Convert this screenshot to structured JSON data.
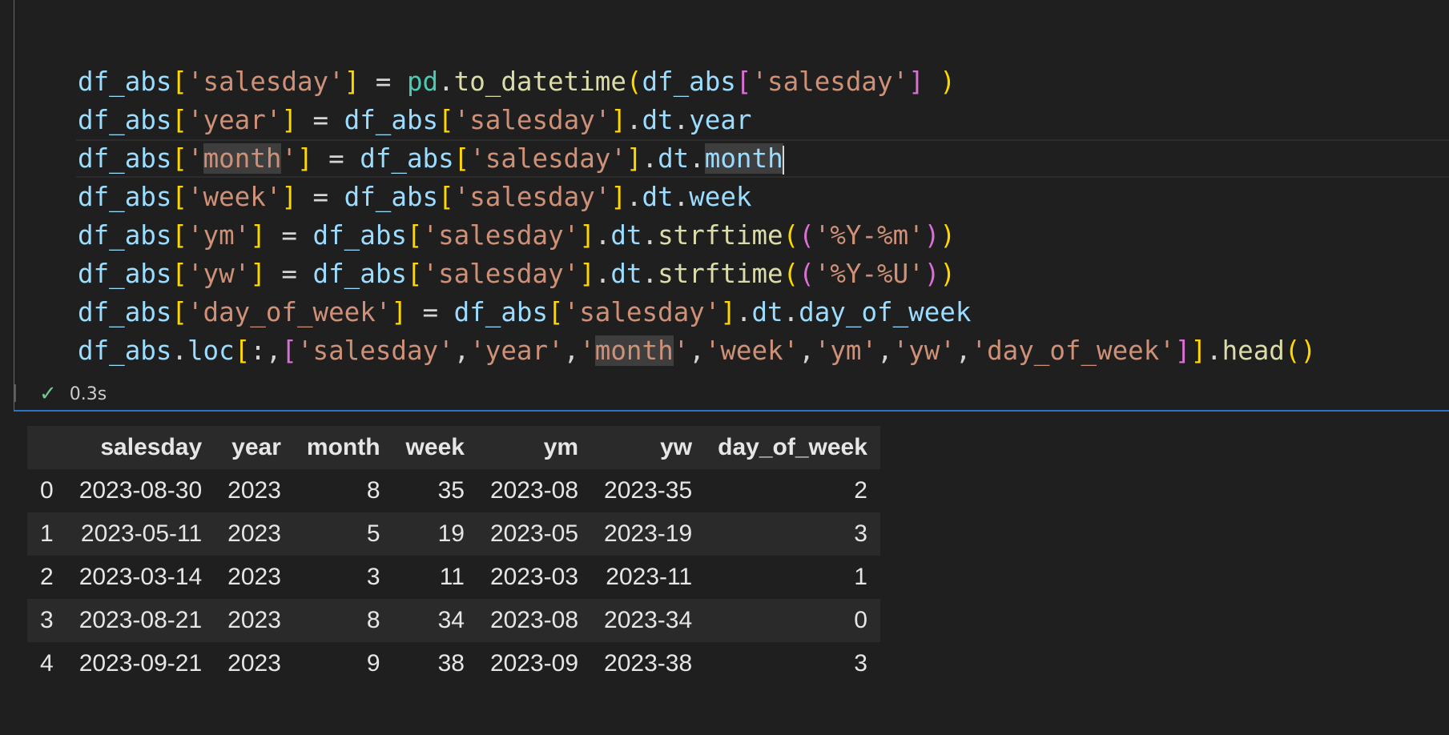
{
  "cell": {
    "lines": [
      [
        [
          "var",
          "df_abs"
        ],
        [
          "b1",
          "["
        ],
        [
          "str",
          "'salesday'"
        ],
        [
          "b1",
          "]"
        ],
        [
          "op",
          " = "
        ],
        [
          "mod",
          "pd"
        ],
        [
          "op",
          "."
        ],
        [
          "fn",
          "to_datetime"
        ],
        [
          "b1",
          "("
        ],
        [
          "var",
          "df_abs"
        ],
        [
          "b2",
          "["
        ],
        [
          "str",
          "'salesday'"
        ],
        [
          "b2",
          "]"
        ],
        [
          "op",
          " "
        ],
        [
          "b1",
          ")"
        ]
      ],
      [
        [
          "var",
          "df_abs"
        ],
        [
          "b1",
          "["
        ],
        [
          "str",
          "'year'"
        ],
        [
          "b1",
          "]"
        ],
        [
          "op",
          " = "
        ],
        [
          "var",
          "df_abs"
        ],
        [
          "b1",
          "["
        ],
        [
          "str",
          "'salesday'"
        ],
        [
          "b1",
          "]"
        ],
        [
          "op",
          "."
        ],
        [
          "var",
          "dt"
        ],
        [
          "op",
          "."
        ],
        [
          "var",
          "year"
        ]
      ],
      [
        [
          "var",
          "df_abs"
        ],
        [
          "b1",
          "["
        ],
        [
          "str",
          "'"
        ],
        [
          "str hl",
          "month"
        ],
        [
          "str",
          "'"
        ],
        [
          "b1",
          "]"
        ],
        [
          "op",
          " = "
        ],
        [
          "var",
          "df_abs"
        ],
        [
          "b1",
          "["
        ],
        [
          "str",
          "'salesday'"
        ],
        [
          "b1",
          "]"
        ],
        [
          "op",
          "."
        ],
        [
          "var",
          "dt"
        ],
        [
          "op",
          "."
        ],
        [
          "var hl",
          "month"
        ],
        [
          "cursor",
          ""
        ]
      ],
      [
        [
          "var",
          "df_abs"
        ],
        [
          "b1",
          "["
        ],
        [
          "str",
          "'week'"
        ],
        [
          "b1",
          "]"
        ],
        [
          "op",
          " = "
        ],
        [
          "var",
          "df_abs"
        ],
        [
          "b1",
          "["
        ],
        [
          "str",
          "'salesday'"
        ],
        [
          "b1",
          "]"
        ],
        [
          "op",
          "."
        ],
        [
          "var",
          "dt"
        ],
        [
          "op",
          "."
        ],
        [
          "var",
          "week"
        ]
      ],
      [
        [
          "var",
          "df_abs"
        ],
        [
          "b1",
          "["
        ],
        [
          "str",
          "'ym'"
        ],
        [
          "b1",
          "]"
        ],
        [
          "op",
          " = "
        ],
        [
          "var",
          "df_abs"
        ],
        [
          "b1",
          "["
        ],
        [
          "str",
          "'salesday'"
        ],
        [
          "b1",
          "]"
        ],
        [
          "op",
          "."
        ],
        [
          "var",
          "dt"
        ],
        [
          "op",
          "."
        ],
        [
          "fn",
          "strftime"
        ],
        [
          "b1",
          "("
        ],
        [
          "b2",
          "("
        ],
        [
          "str",
          "'%Y-%m'"
        ],
        [
          "b2",
          ")"
        ],
        [
          "b1",
          ")"
        ]
      ],
      [
        [
          "var",
          "df_abs"
        ],
        [
          "b1",
          "["
        ],
        [
          "str",
          "'yw'"
        ],
        [
          "b1",
          "]"
        ],
        [
          "op",
          " = "
        ],
        [
          "var",
          "df_abs"
        ],
        [
          "b1",
          "["
        ],
        [
          "str",
          "'salesday'"
        ],
        [
          "b1",
          "]"
        ],
        [
          "op",
          "."
        ],
        [
          "var",
          "dt"
        ],
        [
          "op",
          "."
        ],
        [
          "fn",
          "strftime"
        ],
        [
          "b1",
          "("
        ],
        [
          "b2",
          "("
        ],
        [
          "str",
          "'%Y-%U'"
        ],
        [
          "b2",
          ")"
        ],
        [
          "b1",
          ")"
        ]
      ],
      [
        [
          "var",
          "df_abs"
        ],
        [
          "b1",
          "["
        ],
        [
          "str",
          "'day_of_week'"
        ],
        [
          "b1",
          "]"
        ],
        [
          "op",
          " = "
        ],
        [
          "var",
          "df_abs"
        ],
        [
          "b1",
          "["
        ],
        [
          "str",
          "'salesday'"
        ],
        [
          "b1",
          "]"
        ],
        [
          "op",
          "."
        ],
        [
          "var",
          "dt"
        ],
        [
          "op",
          "."
        ],
        [
          "var",
          "day_of_week"
        ]
      ],
      [
        [
          "var",
          "df_abs"
        ],
        [
          "op",
          "."
        ],
        [
          "var",
          "loc"
        ],
        [
          "b1",
          "["
        ],
        [
          "op",
          ":,"
        ],
        [
          "b2",
          "["
        ],
        [
          "str",
          "'salesday'"
        ],
        [
          "op",
          ","
        ],
        [
          "str",
          "'year'"
        ],
        [
          "op",
          ","
        ],
        [
          "str",
          "'"
        ],
        [
          "str hl",
          "month"
        ],
        [
          "str",
          "'"
        ],
        [
          "op",
          ","
        ],
        [
          "str",
          "'week'"
        ],
        [
          "op",
          ","
        ],
        [
          "str",
          "'ym'"
        ],
        [
          "op",
          ","
        ],
        [
          "str",
          "'yw'"
        ],
        [
          "op",
          ","
        ],
        [
          "str",
          "'day_of_week'"
        ],
        [
          "b2",
          "]"
        ],
        [
          "b1",
          "]"
        ],
        [
          "op",
          "."
        ],
        [
          "fn",
          "head"
        ],
        [
          "b1",
          "()"
        ]
      ]
    ],
    "current_line": 2,
    "status": {
      "icon": "check-icon",
      "time": "0.3s"
    }
  },
  "table": {
    "columns": [
      "",
      "salesday",
      "year",
      "month",
      "week",
      "ym",
      "yw",
      "day_of_week"
    ],
    "rows": [
      [
        "0",
        "2023-08-30",
        "2023",
        "8",
        "35",
        "2023-08",
        "2023-35",
        "2"
      ],
      [
        "1",
        "2023-05-11",
        "2023",
        "5",
        "19",
        "2023-05",
        "2023-19",
        "3"
      ],
      [
        "2",
        "2023-03-14",
        "2023",
        "3",
        "11",
        "2023-03",
        "2023-11",
        "1"
      ],
      [
        "3",
        "2023-08-21",
        "2023",
        "8",
        "34",
        "2023-08",
        "2023-34",
        "0"
      ],
      [
        "4",
        "2023-09-21",
        "2023",
        "9",
        "38",
        "2023-09",
        "2023-38",
        "3"
      ]
    ]
  },
  "colors": {
    "editor_bg": "#1f1f1f",
    "cell_border": "#2d74c4",
    "variable": "#9cdcfe",
    "module": "#4ec9b0",
    "function": "#dcdcaa",
    "string": "#ce9178",
    "bracket_1": "#ffd700",
    "bracket_2": "#da70d6",
    "success": "#73c991"
  }
}
